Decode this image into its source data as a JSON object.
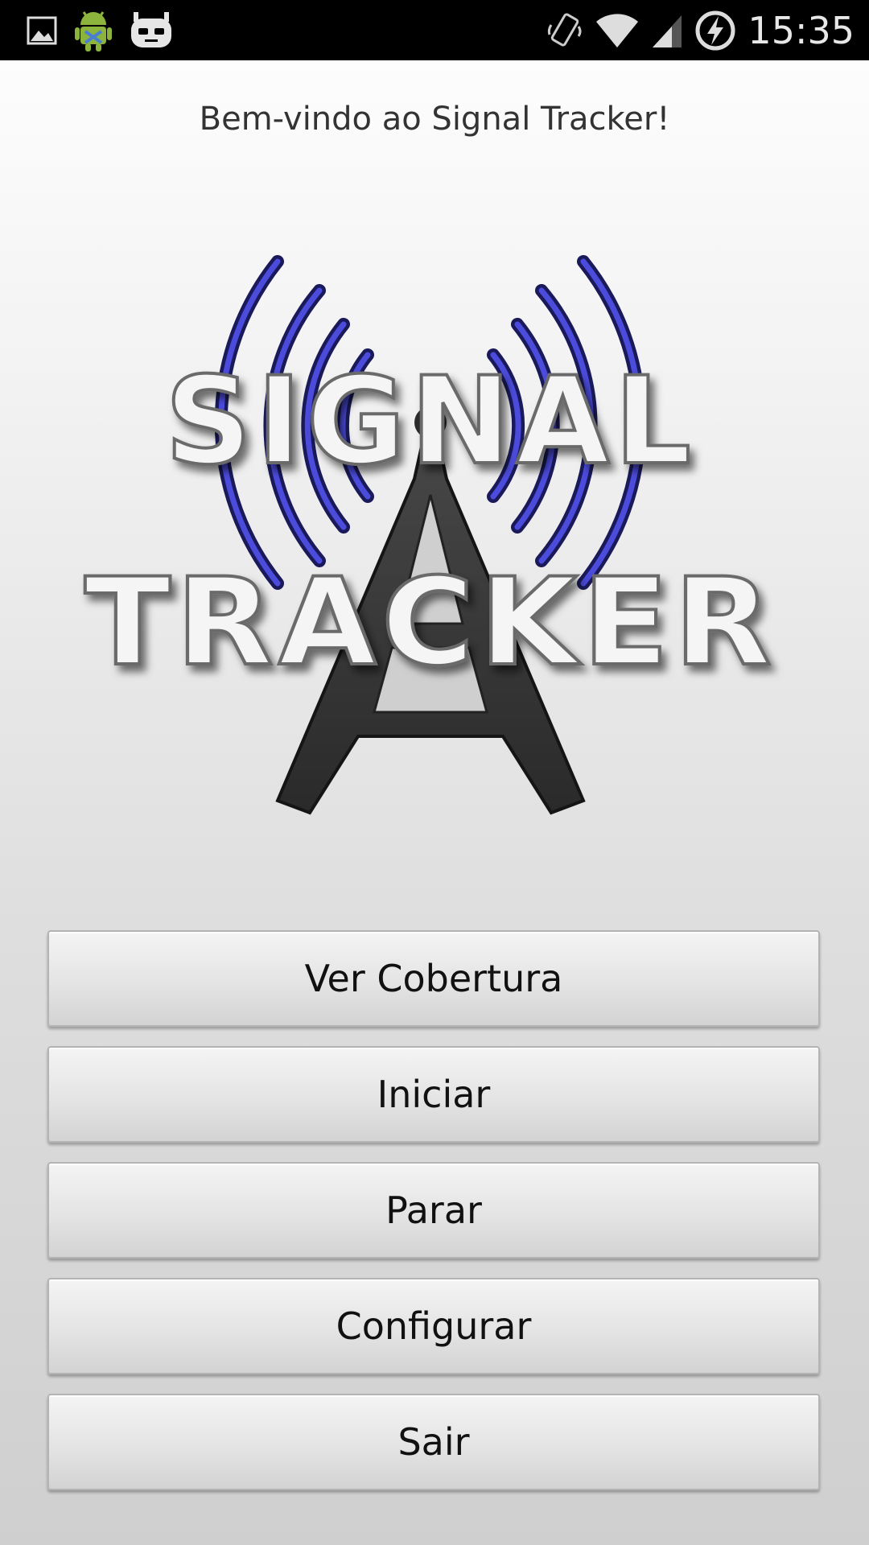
{
  "status_bar": {
    "time": "15:35",
    "left_icons": [
      "image-notification-icon",
      "android-debug-icon",
      "cyanogenmod-icon"
    ],
    "right_icons": [
      "vibrate-icon",
      "wifi-icon",
      "cell-signal-icon",
      "battery-charging-icon"
    ]
  },
  "welcome_text": "Bem-vindo ao Signal Tracker!",
  "logo": {
    "line1": "SIGNAL",
    "line2": "TRACKER",
    "wave_color": "#3333cc"
  },
  "buttons": {
    "view_coverage": "Ver Cobertura",
    "start": "Iniciar",
    "stop": "Parar",
    "configure": "Configurar",
    "exit": "Sair"
  }
}
